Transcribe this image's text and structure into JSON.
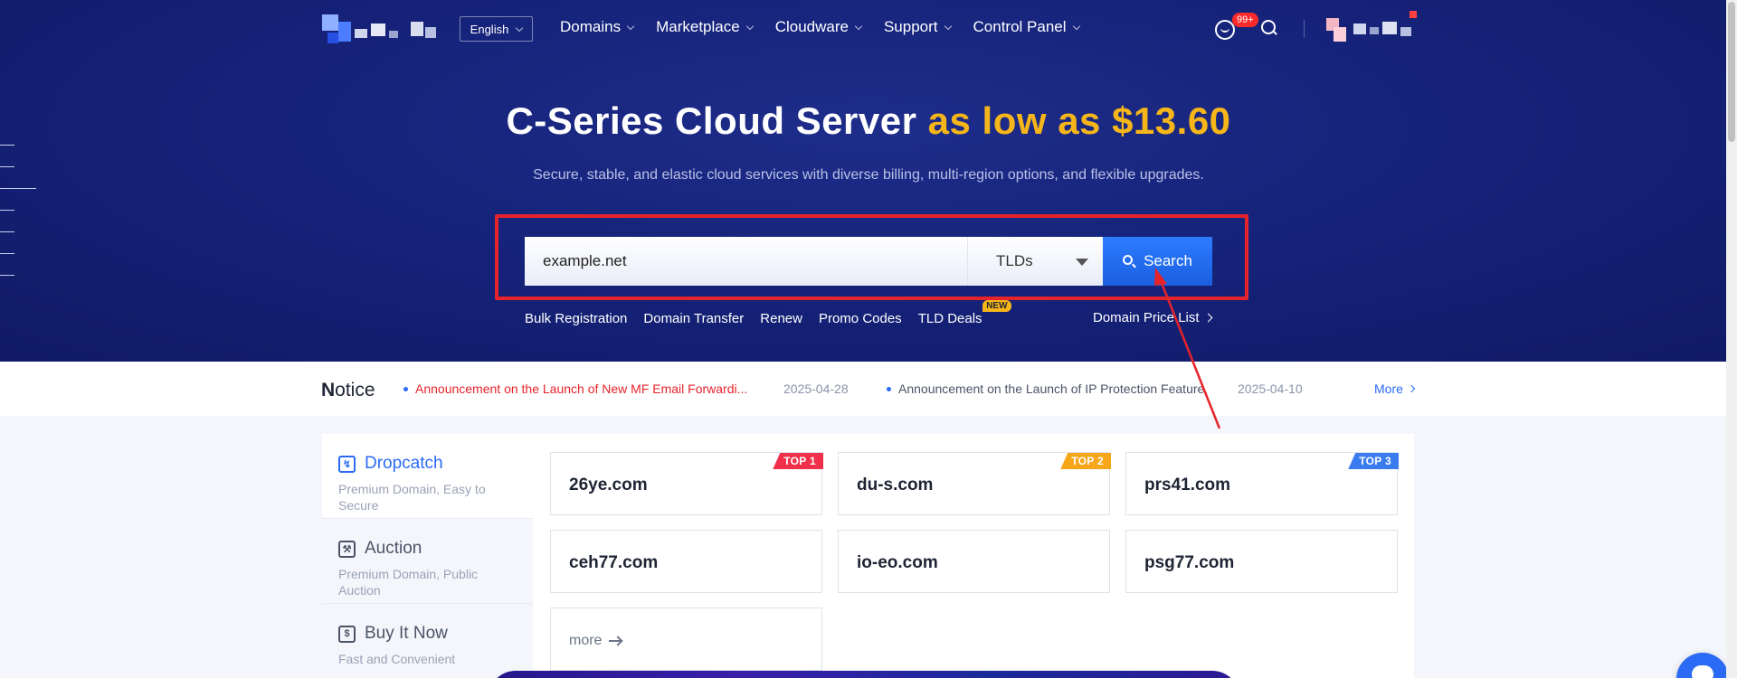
{
  "nav": {
    "language_label": "English",
    "menu": [
      {
        "label": "Domains"
      },
      {
        "label": "Marketplace"
      },
      {
        "label": "Cloudware"
      },
      {
        "label": "Support"
      },
      {
        "label": "Control Panel"
      }
    ],
    "notification_badge": "99+"
  },
  "hero": {
    "title_main": "C-Series Cloud Server",
    "title_highlight": "as low as $13.60",
    "subtitle": "Secure, stable, and elastic cloud services with diverse billing, multi-region options, and flexible upgrades."
  },
  "search": {
    "input_value": "example.net",
    "tld_label": "TLDs",
    "button_label": "Search"
  },
  "quick_links": [
    {
      "label": "Bulk Registration"
    },
    {
      "label": "Domain Transfer"
    },
    {
      "label": "Renew"
    },
    {
      "label": "Promo Codes"
    },
    {
      "label": "TLD Deals",
      "tag": "NEW"
    }
  ],
  "price_list_label": "Domain Price List",
  "notice": {
    "title_first": "N",
    "title_rest": "otice",
    "items": [
      {
        "text": "Announcement on the Launch of New MF Email Forwardi...",
        "date": "2025-04-28",
        "color": "#e5232a"
      },
      {
        "text": "Announcement on the Launch of IP Protection Feature",
        "date": "2025-04-10",
        "color": "#4b5367"
      }
    ],
    "more_label": "More"
  },
  "side_menu": [
    {
      "title": "Dropcatch",
      "desc": "Premium Domain, Easy to Secure",
      "icon": "lightning-icon",
      "active": true
    },
    {
      "title": "Auction",
      "desc": "Premium Domain, Public Auction",
      "icon": "gavel-icon",
      "active": false
    },
    {
      "title": "Buy It Now",
      "desc": "Fast and Convenient",
      "icon": "dollar-icon",
      "active": false
    }
  ],
  "domains": [
    {
      "name": "26ye.com",
      "tag": "TOP 1",
      "tag_color": "#f0304a"
    },
    {
      "name": "du-s.com",
      "tag": "TOP 2",
      "tag_color": "#f6a619"
    },
    {
      "name": "prs41.com",
      "tag": "TOP 3",
      "tag_color": "#3a7cf0"
    },
    {
      "name": "ceh77.com"
    },
    {
      "name": "io-eo.com"
    },
    {
      "name": "psg77.com"
    }
  ],
  "more_card_label": "more"
}
